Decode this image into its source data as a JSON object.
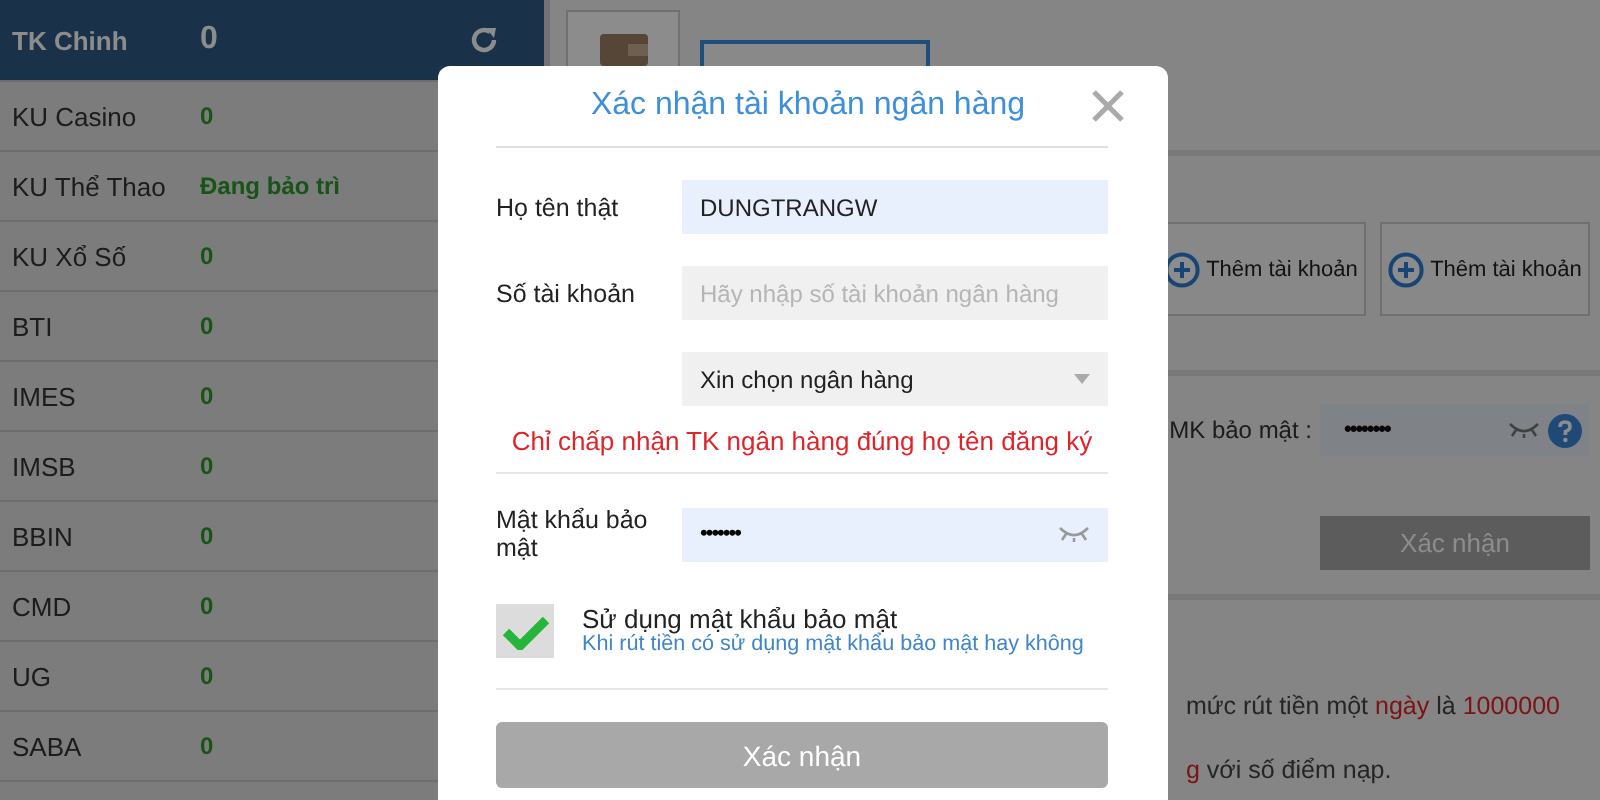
{
  "sidebar": {
    "items": [
      {
        "name": "TK Chinh",
        "value": "0",
        "selected": true
      },
      {
        "name": "KU Casino",
        "value": "0",
        "selected": false
      },
      {
        "name": "KU Thể Thao",
        "value": "Đang bảo trì",
        "selected": false
      },
      {
        "name": "KU Xổ Số",
        "value": "0",
        "selected": false
      },
      {
        "name": "BTI",
        "value": "0",
        "selected": false
      },
      {
        "name": "IMES",
        "value": "0",
        "selected": false
      },
      {
        "name": "IMSB",
        "value": "0",
        "selected": false
      },
      {
        "name": "BBIN",
        "value": "0",
        "selected": false
      },
      {
        "name": "CMD",
        "value": "0",
        "selected": false
      },
      {
        "name": "UG",
        "value": "0",
        "selected": false
      },
      {
        "name": "SABA",
        "value": "0",
        "selected": false
      }
    ]
  },
  "main": {
    "add_buttons": [
      {
        "label": "Thêm tài khoản"
      },
      {
        "label": "Thêm tài khoản"
      }
    ],
    "security": {
      "label": "MK bảo mật :",
      "value": "••••••••"
    },
    "confirm_button": {
      "label": "Xác nhận",
      "disabled": true
    },
    "notes": [
      [
        {
          "text": "mức rút tiền một ",
          "highlight": false
        },
        {
          "text": "ngày",
          "highlight": true
        },
        {
          "text": " là ",
          "highlight": false
        },
        {
          "text": "1000000",
          "highlight": true
        }
      ],
      [
        {
          "text": "g",
          "highlight": true
        },
        {
          "text": " với số điểm nạp.",
          "highlight": false
        }
      ]
    ]
  },
  "modal": {
    "title": "Xác nhận tài khoản ngân hàng",
    "fields": [
      {
        "kind": "text",
        "label": "Họ tên thật",
        "value": "DUNGTRANGW"
      },
      {
        "kind": "text",
        "label": "Số tài khoản",
        "placeholder": "Hãy nhập số tài khoản ngân hàng"
      },
      {
        "kind": "select",
        "value": "Xin chọn ngân hàng"
      }
    ],
    "notice": "Chỉ chấp nhận TK ngân hàng đúng họ tên đăng ký",
    "password": {
      "label": "Mật khẩu bảo mật",
      "value": "•••••••"
    },
    "checkbox": {
      "checked": true,
      "label": "Sử dụng mật khẩu bảo mật",
      "hint": "Khi rút tiền có sử dụng mật khẩu bảo mật hay không"
    },
    "submit": {
      "label": "Xác nhận",
      "disabled": true
    }
  }
}
